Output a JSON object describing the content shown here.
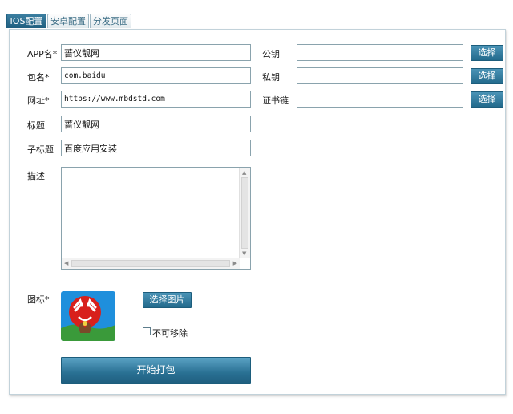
{
  "tabs": [
    {
      "label": "IOS配置",
      "active": true
    },
    {
      "label": "安卓配置",
      "active": false
    },
    {
      "label": "分发页面",
      "active": false
    }
  ],
  "form": {
    "app_name": {
      "label": "APP名*",
      "value": "蔷仪靓网"
    },
    "package": {
      "label": "包名*",
      "value": "com.baidu"
    },
    "url": {
      "label": "网址*",
      "value": "https://www.mbdstd.com"
    },
    "title": {
      "label": "标题",
      "value": "蔷仪靓网"
    },
    "subtitle": {
      "label": "子标题",
      "value": "百度应用安装"
    },
    "description": {
      "label": "描述",
      "value": ""
    },
    "icon_label": "图标*",
    "choose_image_button": "选择图片",
    "not_removable_label": "不可移除",
    "not_removable_checked": false,
    "start_button": "开始打包"
  },
  "keys": {
    "public_key": {
      "label": "公钥",
      "value": "",
      "button": "选择"
    },
    "private_key": {
      "label": "私钥",
      "value": "",
      "button": "选择"
    },
    "cert_chain": {
      "label": "证书链",
      "value": "",
      "button": "选择"
    }
  },
  "colors": {
    "accent": "#236a8c",
    "field_border": "#8aa3ad",
    "icon_bg": "#1f8fdc"
  }
}
